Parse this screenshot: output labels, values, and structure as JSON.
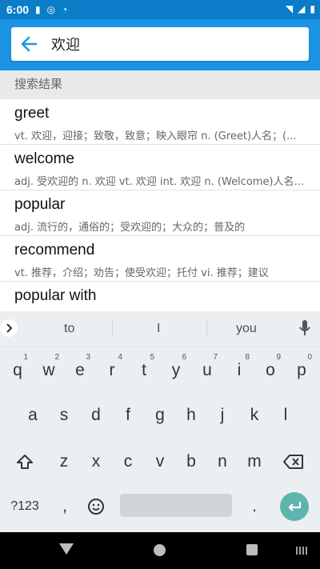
{
  "status_bar": {
    "time": "6:00"
  },
  "search": {
    "query": "欢迎"
  },
  "section_header": "搜索结果",
  "results": [
    {
      "word": "greet",
      "definition": "vt. 欢迎，迎接；致敬，致意；映入眼帘 n. (Greet)人名；(..."
    },
    {
      "word": "welcome",
      "definition": "adj. 受欢迎的 n. 欢迎 vt. 欢迎 int. 欢迎 n. (Welcome)人名；..."
    },
    {
      "word": "popular",
      "definition": "adj. 流行的，通俗的；受欢迎的；大众的；普及的"
    },
    {
      "word": "recommend",
      "definition": "vt. 推荐，介绍；劝告；使受欢迎；托付 vi. 推荐；建议"
    },
    {
      "word": "popular with",
      "definition": ""
    }
  ],
  "keyboard": {
    "suggestions": [
      "to",
      "I",
      "you"
    ],
    "row1": [
      {
        "k": "q",
        "n": "1"
      },
      {
        "k": "w",
        "n": "2"
      },
      {
        "k": "e",
        "n": "3"
      },
      {
        "k": "r",
        "n": "4"
      },
      {
        "k": "t",
        "n": "5"
      },
      {
        "k": "y",
        "n": "6"
      },
      {
        "k": "u",
        "n": "7"
      },
      {
        "k": "i",
        "n": "8"
      },
      {
        "k": "o",
        "n": "9"
      },
      {
        "k": "p",
        "n": "0"
      }
    ],
    "row2": [
      "a",
      "s",
      "d",
      "f",
      "g",
      "h",
      "j",
      "k",
      "l"
    ],
    "row3": [
      "z",
      "x",
      "c",
      "v",
      "b",
      "n",
      "m"
    ],
    "bottom": {
      "symbols": "?123",
      "comma": ",",
      "period": "."
    }
  },
  "colors": {
    "status_bar": "#0b7dc8",
    "header": "#1a94e3",
    "enter_key": "#5fb5ad"
  }
}
